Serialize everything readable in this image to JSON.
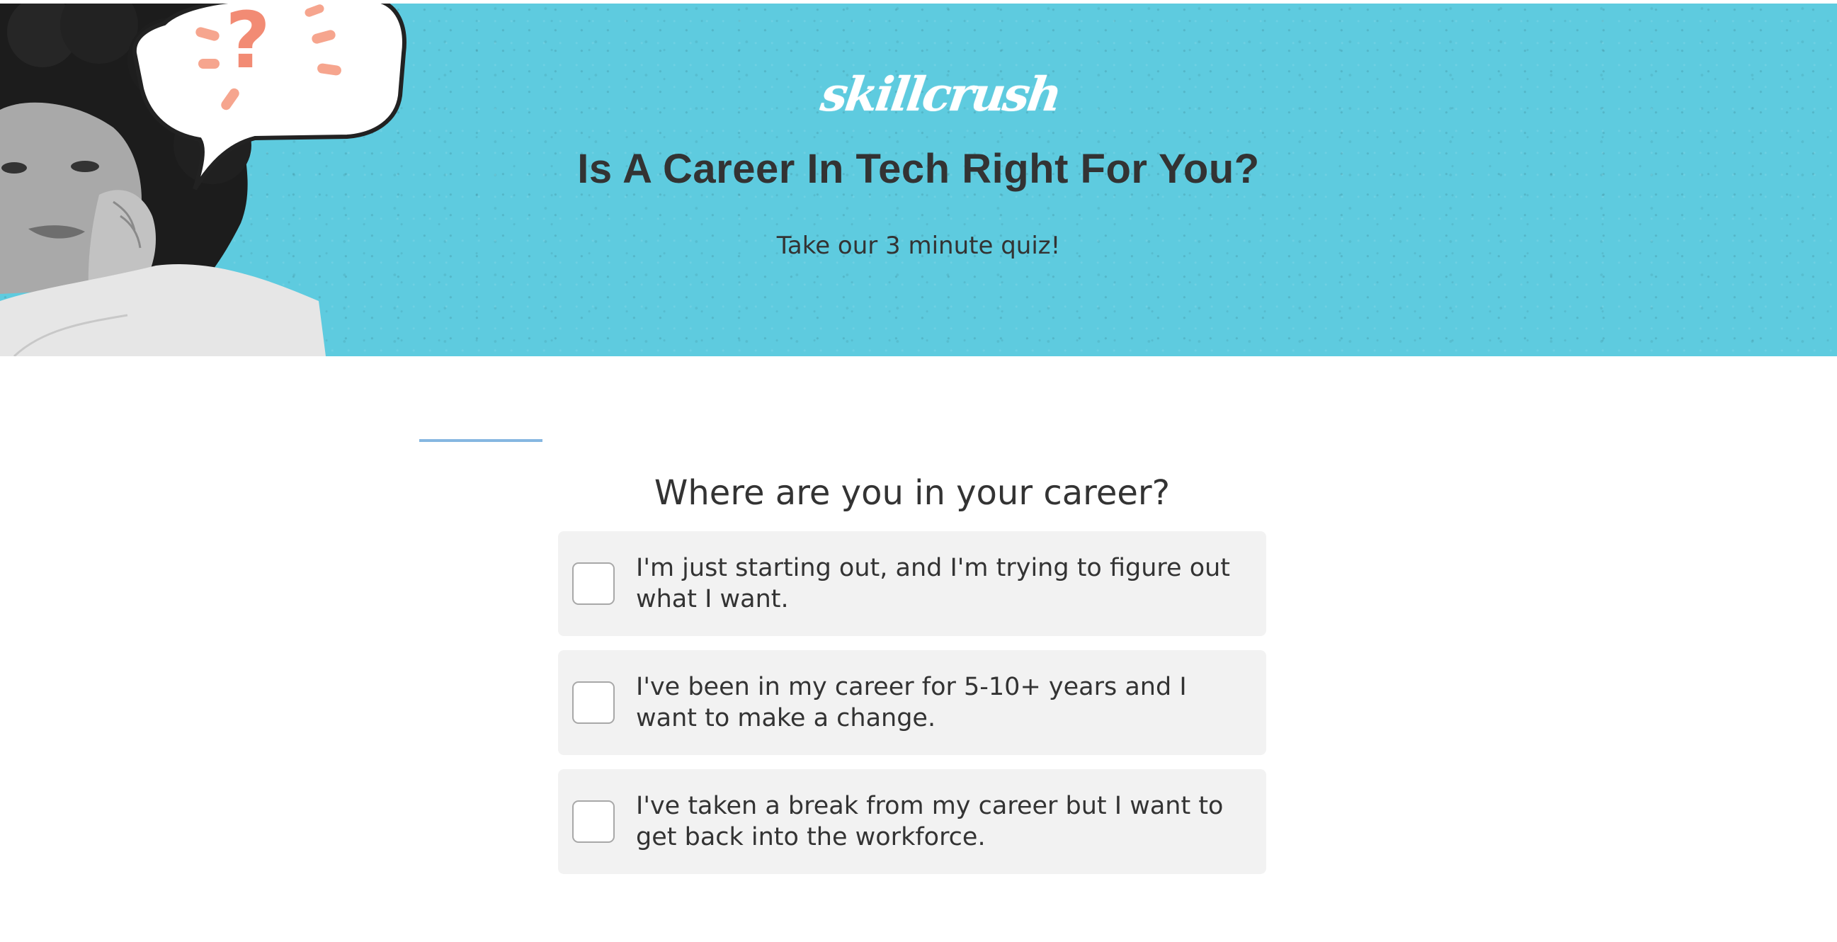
{
  "hero": {
    "logo_text": "skillcrush",
    "title": "Is A Career In Tech Right For You?",
    "subtitle": "Take our 3 minute quiz!",
    "background_color": "#5ecbdf"
  },
  "quiz": {
    "progress_fraction": 0.1,
    "question": "Where are you in your career?",
    "options": [
      {
        "label": "I'm just starting out, and I'm trying to figure out what I want.",
        "checked": false
      },
      {
        "label": "I've been in my career for 5-10+ years and I want to make a change.",
        "checked": false
      },
      {
        "label": "I've taken a break from my career but I want to get back into the workforce.",
        "checked": false
      }
    ]
  },
  "colors": {
    "accent": "#86b7e1",
    "text": "#333333",
    "option_bg": "#f2f2f2",
    "question_mark": "#f28b74"
  }
}
